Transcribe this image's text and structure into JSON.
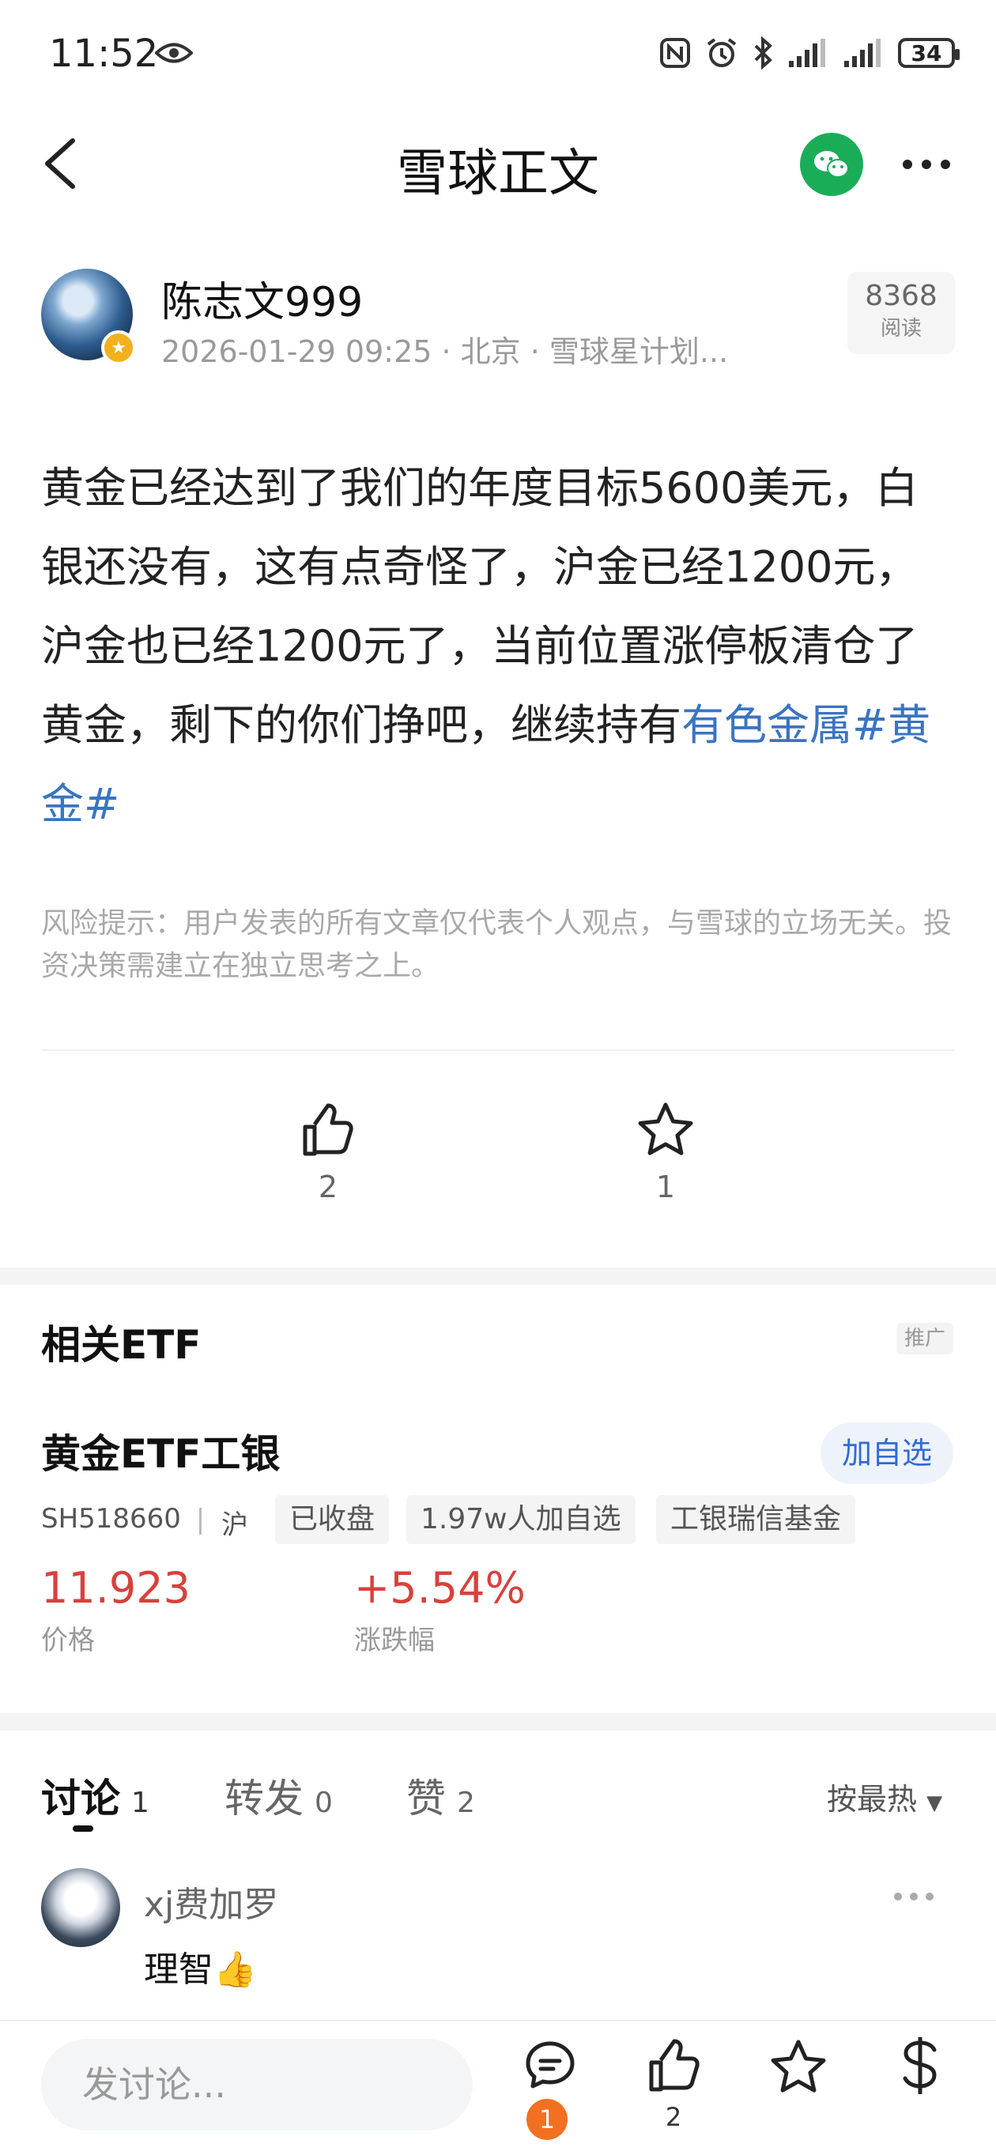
{
  "status": {
    "time": "11:52",
    "battery": "34"
  },
  "header": {
    "title": "雪球正文"
  },
  "post": {
    "author": "陈志文999",
    "meta": "2026-01-29 09:25 · 北京 · 雪球星计划...",
    "read_count": "8368",
    "read_label": "阅读",
    "content_text": "黄金已经达到了我们的年度目标5600美元，白银还没有，这有点奇怪了，沪金已经1200元，沪金也已经1200元了，当前位置涨停板清仓了黄金，剩下的你们挣吧，继续持有",
    "content_link": "有色金属#黄金#",
    "risk_notice": "风险提示：用户发表的所有文章仅代表个人观点，与雪球的立场无关。投资决策需建立在独立思考之上。",
    "likes": "2",
    "favorites": "1"
  },
  "etf": {
    "section_title": "相关ETF",
    "promo": "推广",
    "name": "黄金ETF工银",
    "add_label": "加自选",
    "code": "SH518660",
    "market": "沪",
    "tags": [
      "已收盘",
      "1.97w人加自选",
      "工银瑞信基金"
    ],
    "price": "11.923",
    "price_label": "价格",
    "change": "+5.54%",
    "change_label": "涨跌幅",
    "accent_color": "#d8413d"
  },
  "tabs": [
    {
      "label": "讨论",
      "count": "1"
    },
    {
      "label": "转发",
      "count": "0"
    },
    {
      "label": "赞",
      "count": "2"
    }
  ],
  "sort_label": "按最热",
  "comment": {
    "user": "xj费加罗",
    "text": "理智👍"
  },
  "bottom": {
    "placeholder": "发讨论...",
    "comment_badge": "1",
    "like_count": "2"
  }
}
